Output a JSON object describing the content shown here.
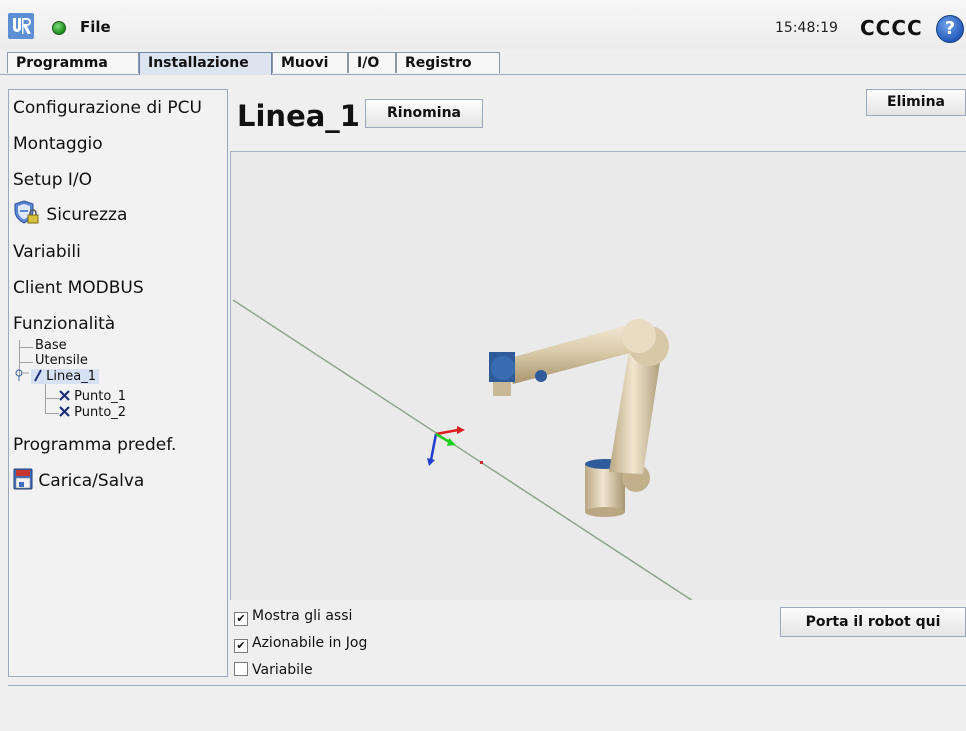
{
  "topbar": {
    "file_label": "File",
    "clock": "15:48:19",
    "robot_name": "CCCC",
    "help_label": "?"
  },
  "tabs": [
    {
      "label": "Programma",
      "active": false
    },
    {
      "label": "Installazione",
      "active": true
    },
    {
      "label": "Muovi",
      "active": false
    },
    {
      "label": "I/O",
      "active": false
    },
    {
      "label": "Registro",
      "active": false
    }
  ],
  "sidebar": {
    "items": [
      {
        "label": "Configurazione di PCU"
      },
      {
        "label": "Montaggio"
      },
      {
        "label": "Setup I/O"
      },
      {
        "label": "Sicurezza",
        "icon": "shield-lock-icon"
      },
      {
        "label": "Variabili"
      },
      {
        "label": "Client MODBUS"
      },
      {
        "label": "Funzionalità"
      },
      {
        "label": "Programma predef."
      },
      {
        "label": "Carica/Salva",
        "icon": "floppy-disk-icon"
      }
    ],
    "features_tree": {
      "base": "Base",
      "tool": "Utensile",
      "line": "Linea_1",
      "points": [
        "Punto_1",
        "Punto_2"
      ]
    }
  },
  "main": {
    "title": "Linea_1",
    "rename_label": "Rinomina",
    "delete_label": "Elimina",
    "move_here_label": "Porta il robot qui",
    "checkboxes": [
      {
        "label": "Mostra gli assi",
        "checked": true
      },
      {
        "label": "Azionabile in Jog",
        "checked": true
      },
      {
        "label": "Variabile",
        "checked": false
      }
    ]
  },
  "colors": {
    "accent": "#6f86a8",
    "status_ok": "#1b8a1b",
    "help": "#1f55b8"
  }
}
